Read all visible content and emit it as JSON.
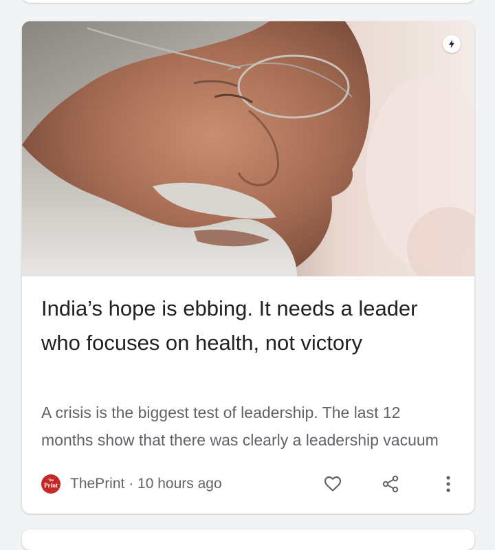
{
  "article": {
    "headline": "India’s hope is ebbing. It needs a leader who focuses on health, not victory",
    "snippet": "A crisis is the biggest test of leadership. The last 12 months show that there was clearly a leadership vacuum",
    "source_name": "ThePrint",
    "separator": " · ",
    "time_ago": "10 hours ago",
    "source_logo_small": "The",
    "source_logo_big": "Print",
    "image_alt": "Close-up portrait of a grey-bearded man wearing rimless glasses"
  },
  "icons": {
    "amp": "lightning-bolt-icon",
    "like": "heart-icon",
    "share": "share-icon",
    "more": "more-vert-icon"
  },
  "colors": {
    "page_background": "#f1f3f4",
    "card_background": "#ffffff",
    "headline_text": "#202124",
    "secondary_text": "#5f6368",
    "source_logo": "#c62828"
  }
}
